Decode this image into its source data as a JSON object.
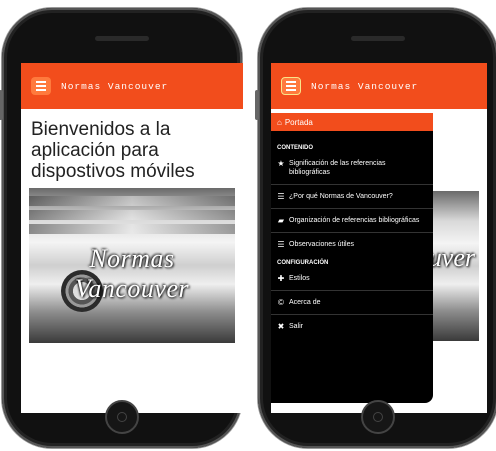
{
  "app": {
    "title": "Normas Vancouver"
  },
  "left_screen": {
    "welcome_text": "Bienvenidos a la aplicación para dispostivos móviles",
    "hero_caption": "Normas Vancouver"
  },
  "right_screen": {
    "hero_caption_partial": "uver",
    "drawer": {
      "active_item": {
        "label": "Portada",
        "icon": "home-icon"
      },
      "sections": [
        {
          "title": "CONTENIDO",
          "items": [
            {
              "label": "Significación de las referencias bibliográficas",
              "icon": "star-icon",
              "glyph": "★"
            },
            {
              "label": "¿Por qué Normas de Vancouver?",
              "icon": "list-icon",
              "glyph": "☰"
            },
            {
              "label": "Organización de referencias bibliográficas",
              "icon": "folder-icon",
              "glyph": "▰"
            },
            {
              "label": "Observaciones útiles",
              "icon": "list-icon",
              "glyph": "☰"
            }
          ]
        },
        {
          "title": "CONFIGURACIÓN",
          "items": [
            {
              "label": "Estilos",
              "icon": "plus-icon",
              "glyph": "✚"
            },
            {
              "label": "Acerca de",
              "icon": "copyright-icon",
              "glyph": "©"
            },
            {
              "label": "Salir",
              "icon": "close-icon",
              "glyph": "✖"
            }
          ]
        }
      ]
    }
  },
  "colors": {
    "accent": "#f24d1c",
    "menu_button": "#ff7a3d",
    "drawer_bg": "#000000"
  }
}
